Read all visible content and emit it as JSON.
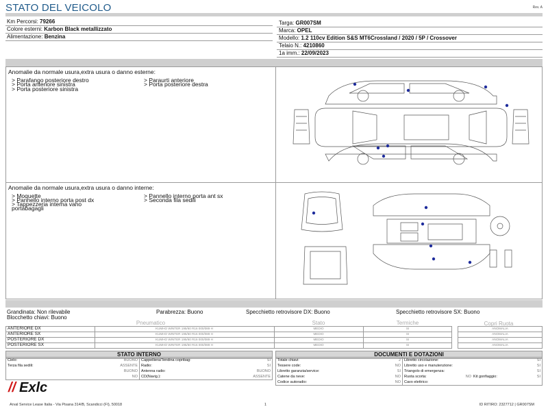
{
  "header": {
    "title": "STATO DEL VEICOLO",
    "rev": "Rev. A"
  },
  "vehicle": {
    "left": [
      {
        "label": "Km Percorsi: ",
        "value": "79266"
      },
      {
        "label": "Colore esterni: ",
        "value": "Karbon Black metallizzato"
      },
      {
        "label": "Alimentazione: ",
        "value": "Benzina"
      }
    ],
    "right": [
      {
        "label": "Targa: ",
        "value": "GR007SM"
      },
      {
        "label": "Marca: ",
        "value": "OPEL"
      },
      {
        "label": "Modello: ",
        "value": "1.2 110cv Edition S&S MT6Crossland / 2020 / 5P / Crossover"
      },
      {
        "label": "Telaio N.: ",
        "value": "4210860"
      },
      {
        "label": "1a imm.: ",
        "value": "22/09/2023"
      }
    ]
  },
  "external_damage": {
    "title": "Anomalie da normale usura,extra usura o danno esterne:",
    "items": [
      "> Parafango posteriore destro",
      "> Porta anteriore sinistra",
      "> Porta posteriore sinistra",
      "> Paraurti anteriore",
      "> Porta posteriore destra"
    ]
  },
  "internal_damage": {
    "title": "Anomalie da normale usura,extra usura o danno interne:",
    "items": [
      "> Moquette",
      "> Pannello interno porta post dx",
      "> Tappezzeria interna vano",
      "portabagagli",
      "> Pannello interno porta ant sx",
      "> Seconda fila sedili"
    ]
  },
  "condition": {
    "line1": [
      "Grandinata: Non rilevabile",
      "Parabrezza: Buono",
      "Specchietto retrovisore DX: Buono",
      "Specchietto retrovisore SX: Buono"
    ],
    "line2": "Blocchetto chiavi: Buono"
  },
  "tyres": {
    "headers": {
      "tyre": "Pneumatico",
      "state": "Stato",
      "wheel": "Termiche",
      "cover": "Copri Ruota"
    },
    "rows": [
      {
        "pos": "ANTERIORE DX",
        "desc": "KUMHO WINTER 195/60 R16 000/089 H",
        "state": "MEDIO",
        "therm": "SI",
        "cover": "ANOMALIA"
      },
      {
        "pos": "ANTERIORE SX",
        "desc": "KUMHO WINTER 195/60 R16 000/089 H",
        "state": "MEDIO",
        "therm": "SI",
        "cover": "ANOMALIA"
      },
      {
        "pos": "POSTERIORE DX",
        "desc": "KUMHO WINTER 195/60 R16 000/089 H",
        "state": "MEDIO",
        "therm": "SI",
        "cover": "ANOMALIA"
      },
      {
        "pos": "POSTERIORE SX",
        "desc": "KUMHO WINTER 195/60 R16 000/089 H",
        "state": "MEDIO",
        "therm": "SI",
        "cover": "ANOMALIA"
      }
    ]
  },
  "internal_state": {
    "title": "STATO INTERNO",
    "col1": [
      {
        "k": "Cielo:",
        "v": "BUONO"
      },
      {
        "k": "Terza fila sedili:",
        "v": "ASSENTE"
      },
      {
        "k": "",
        "v": "BUONO"
      },
      {
        "k": "",
        "v": "NO"
      }
    ],
    "col2": [
      {
        "k": "Cappelliera/Tendina copribag:",
        "v": "SI"
      },
      {
        "k": "Radio:",
        "v": "SI"
      },
      {
        "k": "Antenna radio:",
        "v": "BUONO"
      },
      {
        "k": "CD(Navig.):",
        "v": "ASSENTE"
      }
    ]
  },
  "documents": {
    "title": "DOCUMENTI E DOTAZIONI",
    "col1": [
      {
        "k": "Totale chiavi:",
        "v": "2"
      },
      {
        "k": "Tessere code:",
        "v": "NO"
      },
      {
        "k": "Libretto garanzia/service:",
        "v": "SI"
      },
      {
        "k": "Catene da neve:",
        "v": "NO"
      },
      {
        "k": "Codice autoradio:",
        "v": "NO"
      }
    ],
    "col2": [
      {
        "k": "Libretto circolazione:",
        "v": "SI"
      },
      {
        "k": "Libretto uso e manutenzione:",
        "v": "SI"
      },
      {
        "k": "Triangolo di emergenza:",
        "v": "SI"
      },
      {
        "k": "Ruota scorta:",
        "v": "NO"
      },
      {
        "k": "Cavo elettrico:",
        "v": ""
      }
    ],
    "kit": {
      "k": "Kit gonfiaggio:",
      "v": "SI"
    }
  },
  "footer": {
    "address": "Arval Service Lease Italia - Via Pisana 314/B, Scandicci (FI), 50018",
    "page": "1",
    "id": "ID RITIRO: 2327712 | GR007SM"
  },
  "logo": {
    "text": "Exlc"
  }
}
